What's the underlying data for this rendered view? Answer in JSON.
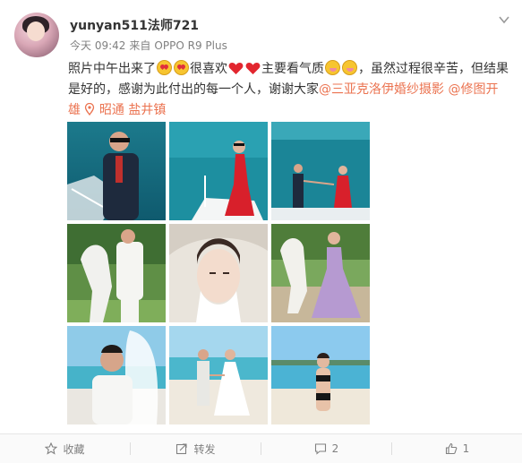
{
  "post": {
    "username": "yunyan511法师721",
    "time": "今天 09:42",
    "source_prefix": "来自",
    "device": "OPPO R9 Plus",
    "text_1": "照片中午出来了",
    "text_2": "很喜欢",
    "text_3": "主要看气质",
    "text_4": "，虽然过程很辛苦，但结果是好的，感谢为此付出的每一个人，谢谢大家",
    "mention_1": "@三亚克洛伊婚纱摄影",
    "mention_2": "@修图开雄",
    "location": "昭通 盐井镇",
    "photos": [
      "groom-on-yacht",
      "bride-red-dress-on-yacht",
      "couple-holding-hands-on-yacht",
      "groom-with-white-horse",
      "bride-veil-closeup",
      "bride-purple-gown-with-horse",
      "couple-embrace-beach",
      "couple-walking-beach",
      "bride-bikini-beach"
    ]
  },
  "actions": {
    "favorite": "收藏",
    "repost": "转发",
    "comments": "2",
    "likes": "1"
  },
  "colors": {
    "link": "#eb7350",
    "meta": "#808080"
  }
}
